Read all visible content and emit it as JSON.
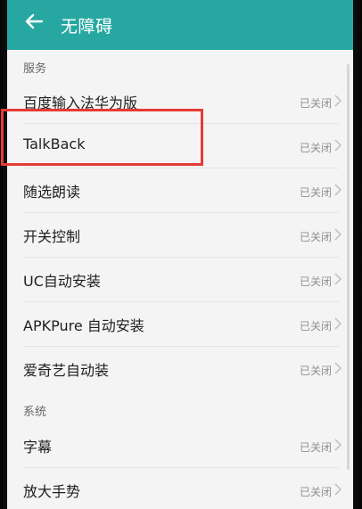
{
  "header": {
    "title": "无障碍",
    "background_color": "#27a7a1",
    "back_icon": "arrow-left-icon"
  },
  "sections": [
    {
      "title": "服务",
      "items": [
        {
          "label": "百度输入法华为版",
          "status": "已关闭"
        },
        {
          "label": "TalkBack",
          "status": "已关闭"
        },
        {
          "label": "随选朗读",
          "status": "已关闭"
        },
        {
          "label": "开关控制",
          "status": "已关闭"
        },
        {
          "label": "UC自动安装",
          "status": "已关闭"
        },
        {
          "label": "APKPure 自动安装",
          "status": "已关闭"
        },
        {
          "label": "爱奇艺自动装",
          "status": "已关闭"
        }
      ]
    },
    {
      "title": "系统",
      "items": [
        {
          "label": "字幕",
          "status": "已关闭"
        },
        {
          "label": "放大手势",
          "status": "已关闭"
        }
      ]
    }
  ],
  "annotation": {
    "highlight_color": "#e63b35",
    "highlighted_item": "TalkBack"
  }
}
